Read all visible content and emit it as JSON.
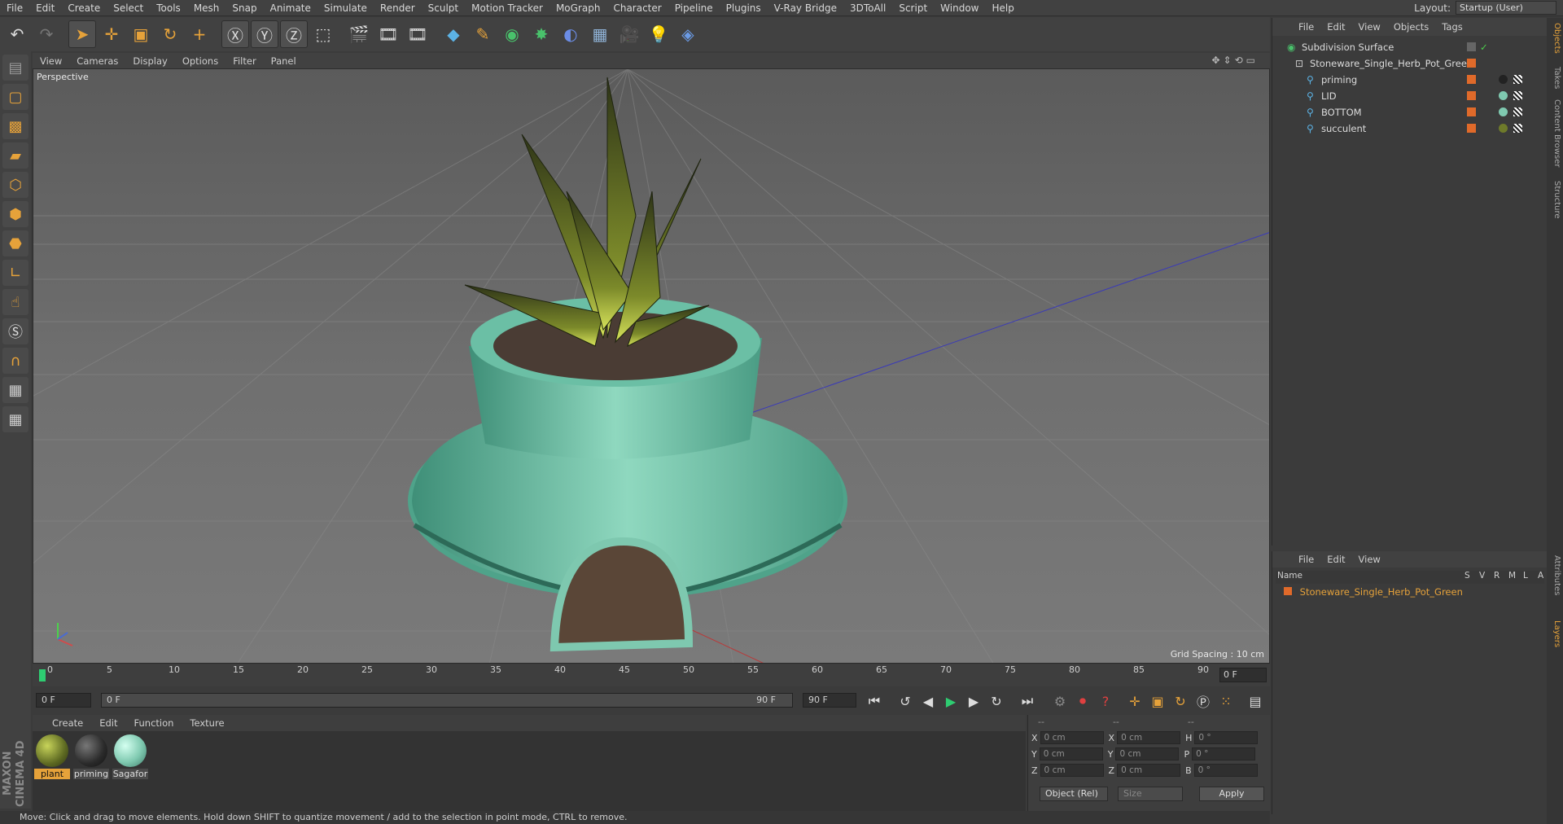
{
  "menubar": [
    "File",
    "Edit",
    "Create",
    "Select",
    "Tools",
    "Mesh",
    "Snap",
    "Animate",
    "Simulate",
    "Render",
    "Sculpt",
    "Motion Tracker",
    "MoGraph",
    "Character",
    "Pipeline",
    "Plugins",
    "V-Ray Bridge",
    "3DToAll",
    "Script",
    "Window",
    "Help"
  ],
  "layout": {
    "label": "Layout:",
    "value": "Startup (User)"
  },
  "viewport": {
    "menu": [
      "View",
      "Cameras",
      "Display",
      "Options",
      "Filter",
      "Panel"
    ],
    "label": "Perspective",
    "grid_spacing": "Grid Spacing : 10 cm"
  },
  "timeline": {
    "ticks": [
      "0",
      "5",
      "10",
      "15",
      "20",
      "25",
      "30",
      "35",
      "40",
      "45",
      "50",
      "55",
      "60",
      "65",
      "70",
      "75",
      "80",
      "85",
      "90"
    ],
    "current_frame": "0 F"
  },
  "transport": {
    "start": "0 F",
    "range_start": "0 F",
    "range_end": "90 F",
    "end": "90 F"
  },
  "materials": {
    "menu": [
      "Create",
      "Edit",
      "Function",
      "Texture"
    ],
    "items": [
      {
        "name": "plant",
        "color": "#6e7a2a",
        "selected": true
      },
      {
        "name": "priming",
        "color": "#2a2a2a",
        "selected": false
      },
      {
        "name": "Sagafor",
        "color": "#7fc9b0",
        "selected": false
      }
    ]
  },
  "coords": {
    "header": [
      "--",
      "--",
      "--"
    ],
    "rows": [
      {
        "a": "X",
        "av": "0 cm",
        "b": "X",
        "bv": "0 cm",
        "c": "H",
        "cv": "0 °"
      },
      {
        "a": "Y",
        "av": "0 cm",
        "b": "Y",
        "bv": "0 cm",
        "c": "P",
        "cv": "0 °"
      },
      {
        "a": "Z",
        "av": "0 cm",
        "b": "Z",
        "bv": "0 cm",
        "c": "B",
        "cv": "0 °"
      }
    ],
    "mode": "Object (Rel)",
    "size": "Size",
    "apply": "Apply"
  },
  "branding": "MAXON CINEMA 4D",
  "status": "Move: Click and drag to move elements. Hold down SHIFT to quantize movement / add to the selection in point mode, CTRL to remove.",
  "objects": {
    "menu": [
      "File",
      "Edit",
      "View",
      "Objects",
      "Tags"
    ],
    "items": [
      {
        "name": "Subdivision Surface",
        "depth": 0
      },
      {
        "name": "Stoneware_Single_Herb_Pot_Green",
        "depth": 1
      },
      {
        "name": "priming",
        "depth": 2
      },
      {
        "name": "LID",
        "depth": 2
      },
      {
        "name": "BOTTOM",
        "depth": 2
      },
      {
        "name": "succulent",
        "depth": 2
      }
    ]
  },
  "attributes": {
    "menu": [
      "File",
      "Edit",
      "View"
    ],
    "columns": [
      "Name",
      "S",
      "V",
      "R",
      "M",
      "L",
      "A"
    ],
    "row": "Stoneware_Single_Herb_Pot_Green"
  },
  "right_tabs": [
    "Objects",
    "Takes",
    "Content Browser",
    "Structure",
    "Attributes",
    "Layers"
  ],
  "accent": "#e6a23a"
}
